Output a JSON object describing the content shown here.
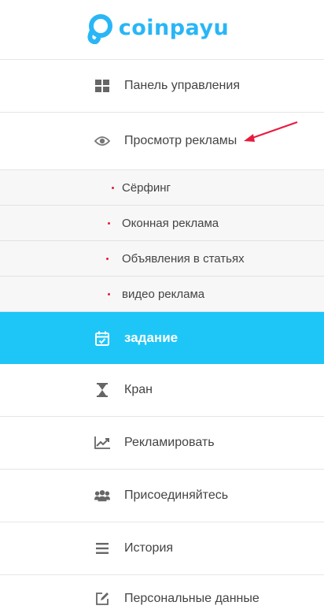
{
  "brand": {
    "name": "coinpayu",
    "color": "#29b6f6"
  },
  "accent": "#1ec6f7",
  "dot_color": "#e8193c",
  "menu": {
    "dashboard": {
      "label": "Панель управления",
      "icon": "grid-icon"
    },
    "view_ads": {
      "label": "Просмотр рекламы",
      "icon": "eye-icon"
    },
    "sub_items": [
      {
        "label": "Сёрфинг"
      },
      {
        "label": "Оконная реклама"
      },
      {
        "label": "Объявления в статьях"
      },
      {
        "label": "видео реклама"
      }
    ],
    "tasks": {
      "label": "задание",
      "icon": "calendar-check-icon",
      "active": true
    },
    "faucet": {
      "label": "Кран",
      "icon": "hourglass-icon"
    },
    "advertise": {
      "label": "Рекламировать",
      "icon": "chart-line-icon"
    },
    "referrals": {
      "label": "Присоединяйтесь",
      "icon": "users-icon"
    },
    "history": {
      "label": "История",
      "icon": "list-icon"
    },
    "profile": {
      "label": "Персональные данные",
      "icon": "edit-icon"
    }
  },
  "annotation": {
    "icon": "red-arrow-icon"
  }
}
